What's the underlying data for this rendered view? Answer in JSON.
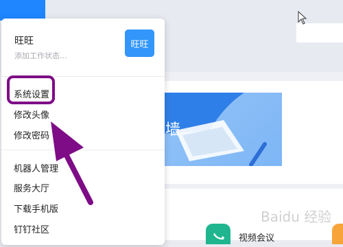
{
  "menu": {
    "user_name": "旺旺",
    "status_placeholder": "添加工作状态...",
    "avatar_text": "旺旺",
    "items": [
      {
        "label": "系统设置"
      },
      {
        "label": "修改头像"
      },
      {
        "label": "修改密码"
      },
      {
        "label": "机器人管理"
      },
      {
        "label": "服务大厅"
      },
      {
        "label": "下载手机版"
      },
      {
        "label": "钉钉社区"
      }
    ]
  },
  "background": {
    "banner_text": "墙",
    "video_label": "视频会议",
    "watermark": "Baidu 经验"
  },
  "colors": {
    "accent_blue": "#1f86ff",
    "avatar_blue": "#3296fa",
    "highlight_purple": "#7d0c86",
    "video_green": "#1fb58e"
  }
}
